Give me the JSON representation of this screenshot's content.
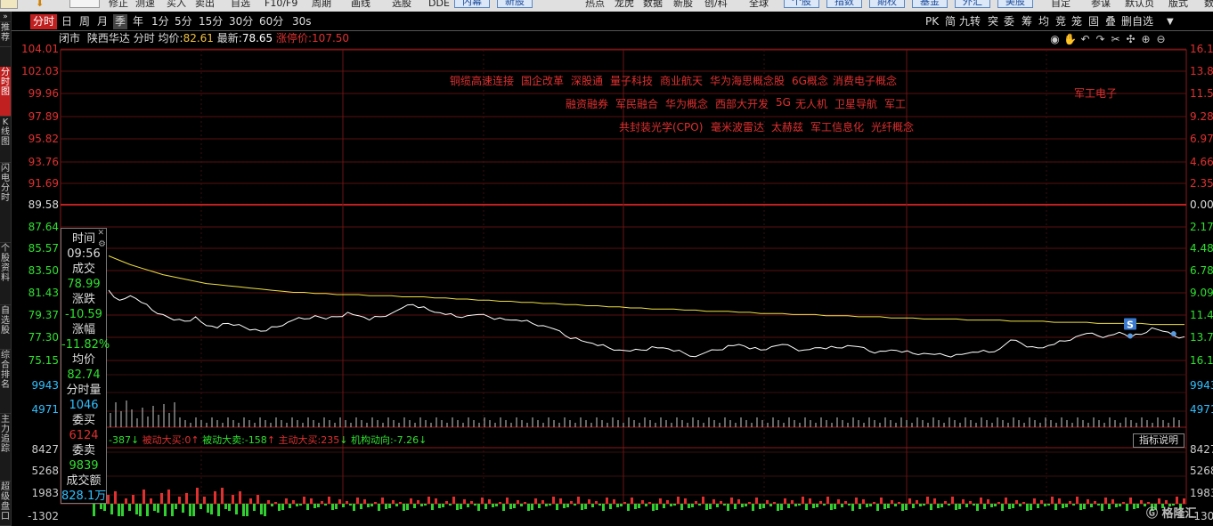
{
  "menubar": {
    "items": [
      "修正",
      "测速",
      "买入",
      "卖出",
      "自选",
      "F10/F9",
      "周期",
      "画线",
      "选股",
      "DDE",
      "热点",
      "龙虎",
      "数据",
      "新股",
      "创/科",
      "全球",
      "自定",
      "参谋",
      "默认页",
      "版式",
      "数"
    ],
    "buttons": [
      "内幕",
      "新股",
      "个股",
      "指数",
      "期权",
      "基金",
      "外汇",
      "美股"
    ]
  },
  "sidebar": [
    "推荐",
    "分时图",
    "K线图",
    "闪电分时",
    "个股资料",
    "自选股",
    "综合排名",
    "主力追踪",
    "超级盘口"
  ],
  "toolbar": {
    "periods": [
      "分时",
      "日",
      "周",
      "月",
      "季",
      "年",
      "1分",
      "5分",
      "15分",
      "30分",
      "60分",
      "30s"
    ],
    "tools": [
      "PK",
      "简",
      "九转",
      "突",
      "委",
      "筹",
      "均",
      "竞",
      "笼",
      "固",
      "叠",
      "删自选",
      "▼"
    ]
  },
  "info": {
    "status": "闭市",
    "name": "陕西华达",
    "mode": "分时",
    "avg_label": "均价:",
    "avg_value": "82.61",
    "last_label": "最新:",
    "last_value": "78.65",
    "limit_label": "涨停价:",
    "limit_value": "107.50"
  },
  "axis_left": [
    "104.01",
    "102.03",
    "99.96",
    "97.89",
    "95.82",
    "93.76",
    "91.69",
    "89.58",
    "87.64",
    "85.57",
    "83.50",
    "81.43",
    "79.37",
    "77.30",
    "75.15"
  ],
  "axis_right": [
    "16.12%",
    "13.81%",
    "11.59%",
    "9.28%",
    "6.97%",
    "4.66%",
    "2.35%",
    "0.00%",
    "2.17%",
    "4.48%",
    "6.78%",
    "9.09%",
    "11.40%",
    "13.71%",
    "16.12%"
  ],
  "vol_axis_left": [
    "9943",
    "4971"
  ],
  "vol_axis_right": [
    "9943",
    "4971"
  ],
  "flow_axis_left": [
    "8427",
    "5268",
    "1983",
    "-1302"
  ],
  "flow_axis_right": [
    "8427",
    "5268",
    "1983",
    "-1302"
  ],
  "concepts": [
    "铜缆高速连接",
    "国企改革",
    "深股通",
    "量子科技",
    "商业航天",
    "华为海思概念股",
    "6G概念",
    "消费电子概念",
    "融资融券",
    "军民融合",
    "华为概念",
    "西部大开发",
    "5G",
    "无人机",
    "卫星导航",
    "军工",
    "共封装光学(CPO)",
    "毫米波雷达",
    "太赫兹",
    "军工信息化",
    "光纤概念",
    "军工电子"
  ],
  "panel": {
    "time_label": "时间",
    "time_value": "09:56",
    "deal_label": "成交",
    "deal_value": "78.99",
    "chg_label": "涨跌",
    "chg_value": "-10.59",
    "pct_label": "涨幅",
    "pct_value": "-11.82%",
    "avg_label": "均价",
    "avg_value": "82.74",
    "vol_label": "分时量",
    "vol_value": "1046",
    "bid_label": "委买",
    "bid_value": "6124",
    "ask_label": "委卖",
    "ask_value": "9839",
    "amt_label": "成交额",
    "amt_value": "828.1万"
  },
  "flow": {
    "v1": "-387",
    "lbl2": "被动大买:",
    "v2": "0",
    "lbl3": "被动大卖:",
    "v3": "-158",
    "lbl4": "主动大买:",
    "v4": "235",
    "lbl5": "机构动向:",
    "v5": "-7.26"
  },
  "indicator_button": "指标说明",
  "signal_marker": "S",
  "logo": "格隆汇",
  "chart_data": {
    "type": "line",
    "prev_close": 89.58,
    "ylim": [
      75.15,
      104.01
    ],
    "series": [
      {
        "values": [
          82.3,
          81.4,
          81.8,
          81.2,
          80.5,
          80.1,
          79.6,
          79.5,
          79.9,
          79.1,
          78.9,
          79.3,
          79.2,
          78.7,
          78.6,
          79.0,
          79.1,
          79.6,
          79.7,
          80.0,
          79.7,
          79.9,
          80.3,
          80.0,
          79.6,
          79.9,
          80.2,
          80.7,
          81.0,
          80.8,
          80.3,
          80.1,
          79.9,
          80.0,
          80.1,
          79.9,
          79.8,
          79.6,
          79.5,
          79.3,
          79.1,
          78.8,
          78.2,
          78.0,
          77.6,
          77.3,
          77.1,
          76.9,
          76.8,
          76.9,
          77.2,
          77.1,
          76.8,
          76.6,
          76.3,
          76.7,
          76.9,
          77.3,
          77.4,
          77.0,
          76.9,
          77.2,
          77.4,
          77.1,
          76.9,
          77.1,
          77.0,
          77.1,
          77.3,
          77.2,
          76.8,
          76.8,
          76.9,
          76.7,
          76.6,
          76.6,
          76.5,
          76.4,
          76.5,
          76.6,
          76.7,
          76.7,
          77.0,
          77.8,
          77.5,
          77.2,
          77.1,
          77.4,
          77.7,
          78.1,
          78.4,
          78.2,
          78.2,
          78.5,
          78.0,
          78.3,
          78.9,
          78.6,
          78.2,
          78.1
        ]
      },
      {
        "values": [
          85.4,
          85.0,
          84.6,
          84.3,
          84.0,
          83.7,
          83.5,
          83.3,
          83.1,
          82.9,
          82.8,
          82.7,
          82.6,
          82.5,
          82.4,
          82.3,
          82.2,
          82.1,
          82.1,
          82.0,
          82.0,
          81.9,
          81.9,
          81.9,
          81.8,
          81.8,
          81.8,
          81.7,
          81.7,
          81.7,
          81.6,
          81.6,
          81.5,
          81.5,
          81.4,
          81.4,
          81.3,
          81.3,
          81.2,
          81.2,
          81.1,
          81.1,
          81.0,
          81.0,
          80.9,
          80.9,
          80.8,
          80.8,
          80.7,
          80.7,
          80.6,
          80.6,
          80.6,
          80.5,
          80.5,
          80.4,
          80.4,
          80.4,
          80.3,
          80.3,
          80.2,
          80.2,
          80.2,
          80.1,
          80.1,
          80.1,
          80.0,
          80.0,
          80.0,
          79.9,
          79.9,
          79.9,
          79.8,
          79.8,
          79.8,
          79.7,
          79.7,
          79.7,
          79.7,
          79.6,
          79.6,
          79.6,
          79.6,
          79.5,
          79.5,
          79.5,
          79.5,
          79.4,
          79.4,
          79.4,
          79.4,
          79.3,
          79.3,
          79.3,
          79.3,
          79.3,
          79.2,
          79.2,
          79.2,
          79.2
        ]
      }
    ]
  }
}
